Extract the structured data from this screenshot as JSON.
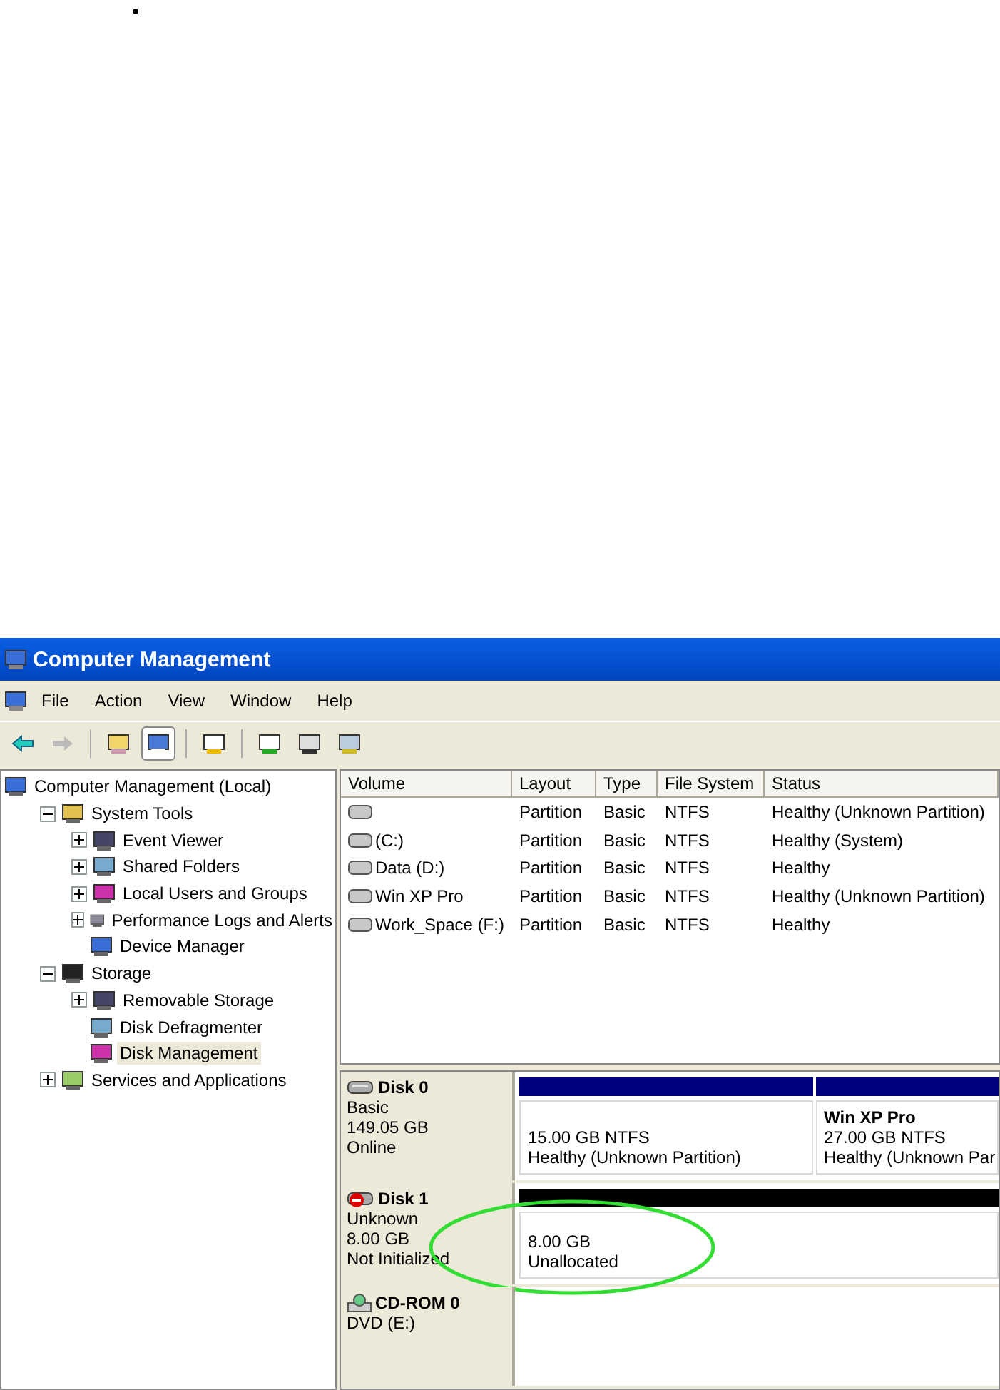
{
  "window": {
    "title": "Computer Management"
  },
  "menu": [
    "File",
    "Action",
    "View",
    "Window",
    "Help"
  ],
  "toolbar": {
    "forward_disabled": true,
    "console_tree_pressed": true
  },
  "tree": [
    {
      "label": "Computer Management (Local)",
      "selected": false,
      "children": [
        {
          "label": "System Tools",
          "expanded": true,
          "selected": false,
          "children": [
            {
              "label": "Event Viewer",
              "expanded": false,
              "selected": false
            },
            {
              "label": "Shared Folders",
              "expanded": false,
              "selected": false
            },
            {
              "label": "Local Users and Groups",
              "expanded": false,
              "selected": false
            },
            {
              "label": "Performance Logs and Alerts",
              "expanded": false,
              "selected": false
            },
            {
              "label": "Device Manager",
              "selected": false
            }
          ]
        },
        {
          "label": "Storage",
          "expanded": true,
          "selected": false,
          "children": [
            {
              "label": "Removable Storage",
              "expanded": false,
              "selected": false
            },
            {
              "label": "Disk Defragmenter",
              "selected": false
            },
            {
              "label": "Disk Management",
              "selected": true
            }
          ]
        },
        {
          "label": "Services and Applications",
          "expanded": false,
          "selected": false
        }
      ]
    }
  ],
  "table": {
    "columns": [
      "Volume",
      "Layout",
      "Type",
      "File System",
      "Status"
    ],
    "rows": [
      [
        "",
        "Partition",
        "Basic",
        "NTFS",
        "Healthy (Unknown Partition)"
      ],
      [
        "(C:)",
        "Partition",
        "Basic",
        "NTFS",
        "Healthy (System)"
      ],
      [
        "Data (D:)",
        "Partition",
        "Basic",
        "NTFS",
        "Healthy"
      ],
      [
        "Win XP Pro",
        "Partition",
        "Basic",
        "NTFS",
        "Healthy (Unknown Partition)"
      ],
      [
        "Work_Space (F:)",
        "Partition",
        "Basic",
        "NTFS",
        "Healthy"
      ]
    ]
  },
  "disks": [
    {
      "kind": "disk",
      "name": "Disk 0",
      "error": false,
      "lines": [
        "Basic",
        "149.05 GB",
        "Online"
      ],
      "partitions": [
        {
          "kind": "primary",
          "lines": [
            "15.00 GB NTFS",
            "Healthy (Unknown Partition)"
          ]
        },
        {
          "kind": "primary",
          "name": "Win XP Pro",
          "lines": [
            "27.00 GB NTFS",
            "Healthy (Unknown Par"
          ]
        }
      ]
    },
    {
      "kind": "disk",
      "name": "Disk 1",
      "error": true,
      "lines": [
        "Unknown",
        "8.00 GB",
        "Not Initialized"
      ],
      "annotated": true,
      "partitions": [
        {
          "kind": "unallocated",
          "lines": [
            "8.00 GB",
            "Unallocated"
          ]
        }
      ]
    },
    {
      "kind": "cdrom",
      "name": "CD-ROM 0",
      "error": false,
      "lines": [
        "DVD (E:)"
      ]
    }
  ]
}
